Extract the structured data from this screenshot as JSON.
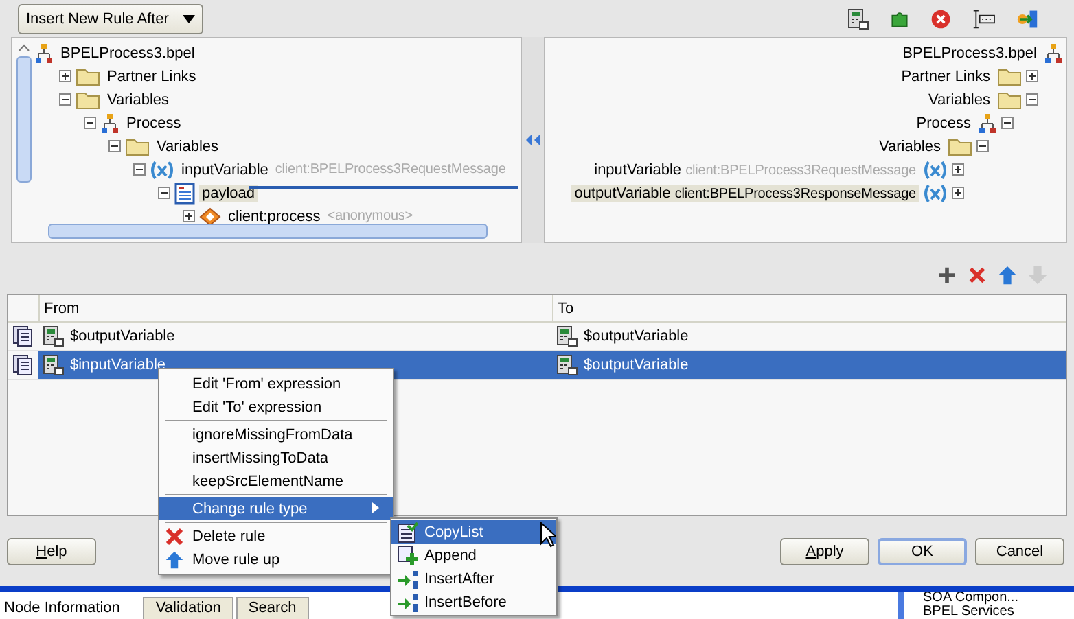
{
  "insert_mode": {
    "value": "Insert New Rule After"
  },
  "toolbar": [
    {
      "kind": "expression"
    },
    {
      "kind": "puzzle"
    },
    {
      "kind": "close"
    },
    {
      "kind": "ruler"
    },
    {
      "kind": "export"
    }
  ],
  "source_tree": {
    "nodes": [
      {
        "label": "BPELProcess3.bpel",
        "kind": "process",
        "selected": false,
        "children": [
          {
            "label": "Partner Links",
            "kind": "folder",
            "expanded": false,
            "selected": false
          },
          {
            "label": "Variables",
            "kind": "folder",
            "expanded": true,
            "selected": false,
            "children": [
              {
                "label": "Process",
                "kind": "process",
                "expanded": true,
                "selected": false,
                "children": [
                  {
                    "label": "Variables",
                    "kind": "folder",
                    "expanded": true,
                    "selected": false,
                    "children": [
                      {
                        "label": "inputVariable",
                        "type": "client:BPELProcess3RequestMessage",
                        "kind": "variable",
                        "expanded": true,
                        "selected": false,
                        "children": [
                          {
                            "label": "payload",
                            "kind": "element",
                            "expanded": true,
                            "selected": true,
                            "children": [
                              {
                                "label": "client:process",
                                "type": "<anonymous>",
                                "kind": "complex",
                                "expanded": false,
                                "selected": false
                              }
                            ]
                          }
                        ]
                      }
                    ]
                  }
                ]
              }
            ]
          }
        ]
      }
    ]
  },
  "target_tree": {
    "nodes": [
      {
        "label": "BPELProcess3.bpel",
        "kind": "process",
        "selected": false,
        "children": [
          {
            "label": "Partner Links",
            "kind": "folder",
            "expanded": false,
            "selected": false
          },
          {
            "label": "Variables",
            "kind": "folder",
            "expanded": true,
            "selected": false,
            "children": [
              {
                "label": "Process",
                "kind": "process",
                "expanded": true,
                "selected": false,
                "children": [
                  {
                    "label": "Variables",
                    "kind": "folder",
                    "expanded": true,
                    "selected": false,
                    "children": [
                      {
                        "label": "inputVariable",
                        "type": "client:BPELProcess3RequestMessage",
                        "kind": "variable",
                        "expanded": false,
                        "selected": false
                      },
                      {
                        "label": "outputVariable",
                        "type": "client:BPELProcess3ResponseMessage",
                        "kind": "variable",
                        "expanded": false,
                        "selected": true
                      }
                    ]
                  }
                ]
              }
            ]
          }
        ]
      }
    ]
  },
  "rule_actions": [
    {
      "kind": "add",
      "disabled": false
    },
    {
      "kind": "delete",
      "disabled": false
    },
    {
      "kind": "up",
      "disabled": false
    },
    {
      "kind": "down",
      "disabled": true
    }
  ],
  "rules_table": {
    "columns": [
      "From",
      "To"
    ],
    "rows": [
      {
        "from": "$outputVariable",
        "to": "$outputVariable",
        "selected": false
      },
      {
        "from": "$inputVariable",
        "to": "$outputVariable",
        "selected": true
      }
    ]
  },
  "context_menu": [
    {
      "kind": "item",
      "label": "Edit 'From' expression",
      "selected": false
    },
    {
      "kind": "item",
      "label": "Edit 'To' expression",
      "selected": false
    },
    {
      "kind": "separator"
    },
    {
      "kind": "item",
      "label": "ignoreMissingFromData",
      "selected": false
    },
    {
      "kind": "item",
      "label": "insertMissingToData",
      "selected": false
    },
    {
      "kind": "item",
      "label": "keepSrcElementName",
      "selected": false
    },
    {
      "kind": "separator"
    },
    {
      "kind": "submenu",
      "label": "Change rule type",
      "selected": true
    },
    {
      "kind": "separator"
    },
    {
      "kind": "delete",
      "label": "Delete rule",
      "selected": false
    },
    {
      "kind": "move_up",
      "label": "Move rule up",
      "selected": false
    }
  ],
  "submenu": [
    {
      "kind": "copylist",
      "label": "CopyList",
      "selected": true
    },
    {
      "kind": "append",
      "label": "Append",
      "selected": false
    },
    {
      "kind": "insert",
      "label": "InsertAfter",
      "selected": false
    },
    {
      "kind": "insert",
      "label": "InsertBefore",
      "selected": false
    }
  ],
  "buttons": [
    {
      "label": "Help",
      "underline_first": true,
      "default": false
    },
    {
      "label": "Apply",
      "underline_first": true,
      "default": false
    },
    {
      "label": "OK",
      "underline_first": false,
      "default": true
    },
    {
      "label": "Cancel",
      "underline_first": false,
      "default": false
    }
  ],
  "ide_strip": {
    "tabs": [
      {
        "label": "Node Information",
        "selected": true
      },
      {
        "label": "Validation",
        "selected": false
      },
      {
        "label": "Search",
        "selected": false
      }
    ],
    "right_items": [
      "SOA Compon...",
      "BPEL Services"
    ]
  }
}
